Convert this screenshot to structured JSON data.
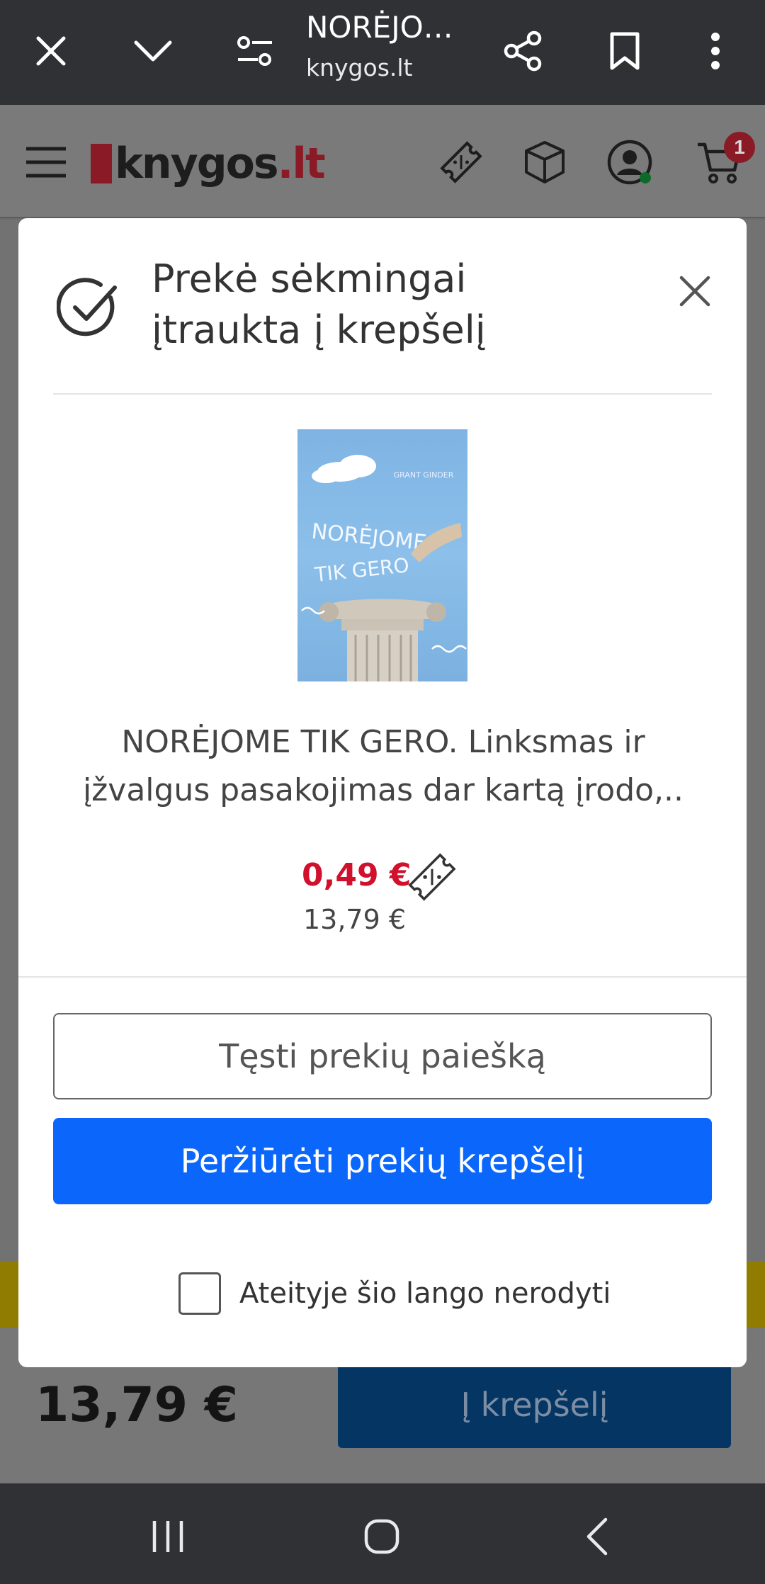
{
  "browser": {
    "title": "NORĖJO…",
    "url": "knygos.lt",
    "icons": [
      "close-icon",
      "chevron-down-icon",
      "page-settings-icon",
      "share-icon",
      "bookmark-icon",
      "more-vert-icon"
    ]
  },
  "site": {
    "logo_text": "knygos",
    "logo_tld": ".lt",
    "cart_count": "1",
    "icons": [
      "menu-icon",
      "coupon-icon",
      "package-icon",
      "account-icon",
      "cart-icon"
    ]
  },
  "background": {
    "price": "13,79 €",
    "add_to_cart": "Į krepšelį"
  },
  "modal": {
    "title": "Prekė sėkmingai įtraukta į krepšelį",
    "product_title": "NORĖJOME TIK GERO. Linksmas ir įžvalgus pasakojimas dar kartą įrodo,..",
    "price_new": "0,49 €",
    "price_old": "13,79 €",
    "continue_button": "Tęsti prekių paiešką",
    "view_cart_button": "Peržiūrėti prekių krepšelį",
    "dont_show_label": "Ateityje šio lango nerodyti",
    "dont_show_checked": false,
    "cover": {
      "author": "GRANT GINDER",
      "title_line1": "NORĖJOME",
      "title_line2": "TIK GERO"
    }
  },
  "colors": {
    "accent_blue": "#0b67fc",
    "sale_red": "#d0102c",
    "brand_red": "#8a1b26"
  }
}
